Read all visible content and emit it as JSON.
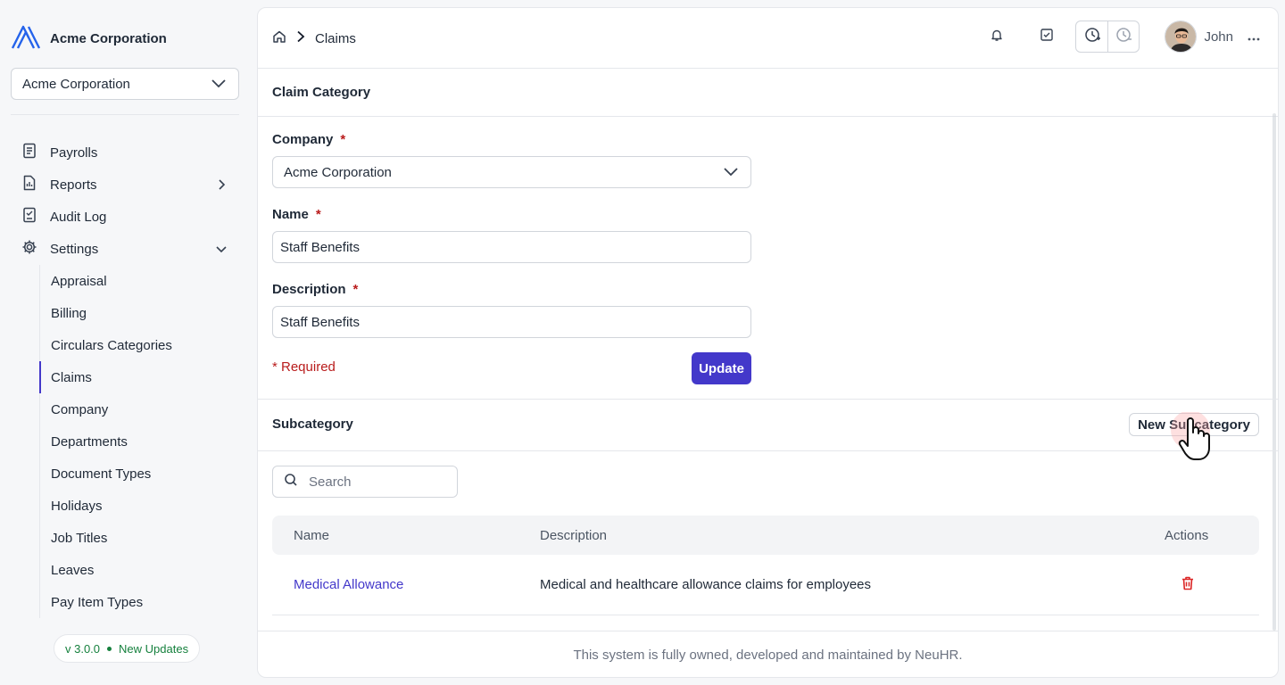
{
  "sidebar": {
    "brand_name": "Acme Corporation",
    "org_select_value": "Acme Corporation",
    "nav": [
      {
        "label": "Payrolls",
        "icon": "receipt-icon"
      },
      {
        "label": "Reports",
        "icon": "document-chart-icon"
      },
      {
        "label": "Audit Log",
        "icon": "clipboard-icon"
      },
      {
        "label": "Settings",
        "icon": "gear-icon"
      }
    ],
    "settings_items": [
      "Appraisal",
      "Billing",
      "Circulars Categories",
      "Claims",
      "Company",
      "Departments",
      "Document Types",
      "Holidays",
      "Job Titles",
      "Leaves",
      "Pay Item Types"
    ],
    "active_settings_item": "Claims",
    "version": "v 3.0.0",
    "updates_label": "New Updates"
  },
  "header": {
    "breadcrumb_current": "Claims",
    "user_name": "John"
  },
  "claim_category": {
    "section_title": "Claim Category",
    "company_label": "Company",
    "company_value": "Acme Corporation",
    "name_label": "Name",
    "name_value": "Staff Benefits",
    "description_label": "Description",
    "description_value": "Staff Benefits",
    "required_asterisk": "*",
    "required_note": "* Required",
    "update_label": "Update"
  },
  "subcategory": {
    "section_title": "Subcategory",
    "new_button_label": "New Subcategory",
    "search_placeholder": "Search",
    "columns": {
      "name": "Name",
      "description": "Description",
      "actions": "Actions"
    },
    "rows": [
      {
        "name": "Medical Allowance",
        "description": "Medical and healthcare allowance claims for employees"
      }
    ]
  },
  "footer": {
    "text": "This system is fully owned, developed and maintained by NeuHR."
  },
  "colors": {
    "accent": "#4338ca",
    "danger": "#b91c1c",
    "success": "#15803d"
  }
}
